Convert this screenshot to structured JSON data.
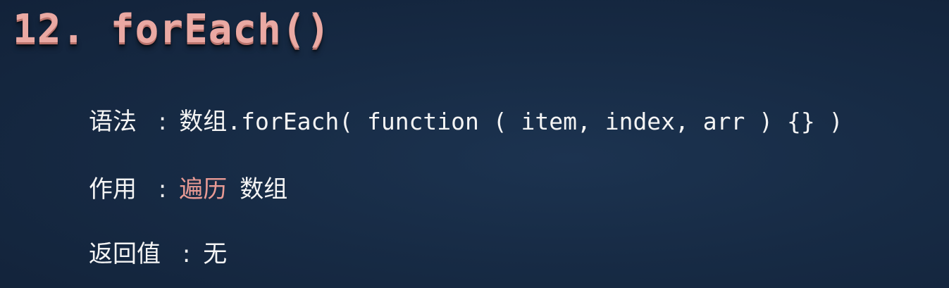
{
  "title": "12. forEach()",
  "syntax": {
    "label": "语法",
    "colon": ":",
    "array_word": "数组",
    "code": ".forEach( function ( item, index, arr ) {} )"
  },
  "effect": {
    "label": "作用",
    "colon": ":",
    "highlight": "遍历",
    "rest": "数组",
    "highlight_color": "#e89a94"
  },
  "return_value": {
    "label": "返回值",
    "colon": ":",
    "value": "无"
  },
  "colors": {
    "background": "#172b45",
    "title": "#eaa9a3",
    "text": "#f4f4f4"
  }
}
